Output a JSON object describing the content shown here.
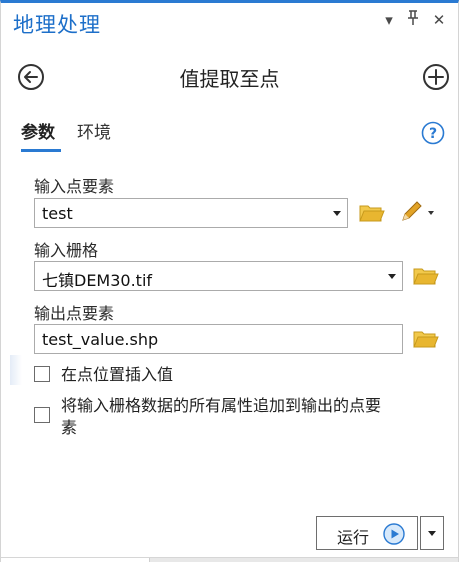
{
  "pane": {
    "title": "地理处理",
    "dropdown_icon": "dropdown-icon",
    "pin_icon": "pin-icon",
    "close_icon": "close-icon"
  },
  "tool": {
    "title": "值提取至点",
    "back_icon": "back-arrow-icon",
    "add_icon": "add-icon"
  },
  "tabs": [
    {
      "label": "参数",
      "active": true
    },
    {
      "label": "环境",
      "active": false
    }
  ],
  "help_icon": "help-icon",
  "params": {
    "input_points": {
      "label": "输入点要素",
      "value": "test"
    },
    "input_raster": {
      "label": "输入栅格",
      "value": "七镇DEM30.tif"
    },
    "output_points": {
      "label": "输出点要素",
      "value": "test_value.shp"
    },
    "interpolate": {
      "label": "在点位置插入值",
      "checked": false
    },
    "append_attrs": {
      "label_line1": "将输入栅格数据的所有属性追加到输出的点要",
      "label_line2": "素",
      "checked": false
    }
  },
  "run": {
    "label": "运行"
  },
  "colors": {
    "accent": "#2a7ad2",
    "folder": "#e0b028",
    "pencil": "#d99a1e"
  }
}
